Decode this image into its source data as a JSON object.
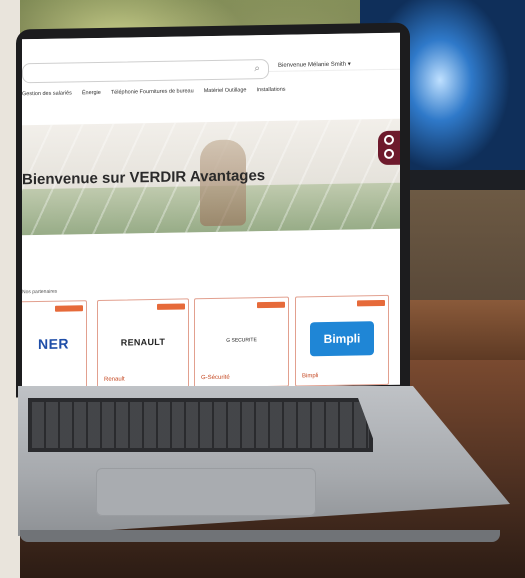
{
  "site": {
    "account_text": "Bienvenue Mélanie Smith ▾",
    "nav": [
      "Gestion des salariés",
      "Énergie",
      "Téléphonie Fournitures de bureau",
      "Matériel Outillage",
      "Installations"
    ],
    "hero_title": "Bienvenue sur VERDIR Avantages",
    "section_caption": "Nos partenaires",
    "cards": [
      {
        "logo_text": "NER",
        "label": ""
      },
      {
        "logo_text": "RENAULT",
        "label": "Renault"
      },
      {
        "logo_text": "G SECURITE",
        "label": "G-Sécurité"
      },
      {
        "logo_text": "Bimpli",
        "label": "Bimpli"
      }
    ]
  },
  "icons": [
    "search-icon",
    "chevron-right-icon",
    "brand-accent-icon"
  ],
  "colors": {
    "accent": "#6e1a2c",
    "tag": "#e66a3a",
    "link": "#c4461f",
    "bimpli": "#1f86d6"
  }
}
